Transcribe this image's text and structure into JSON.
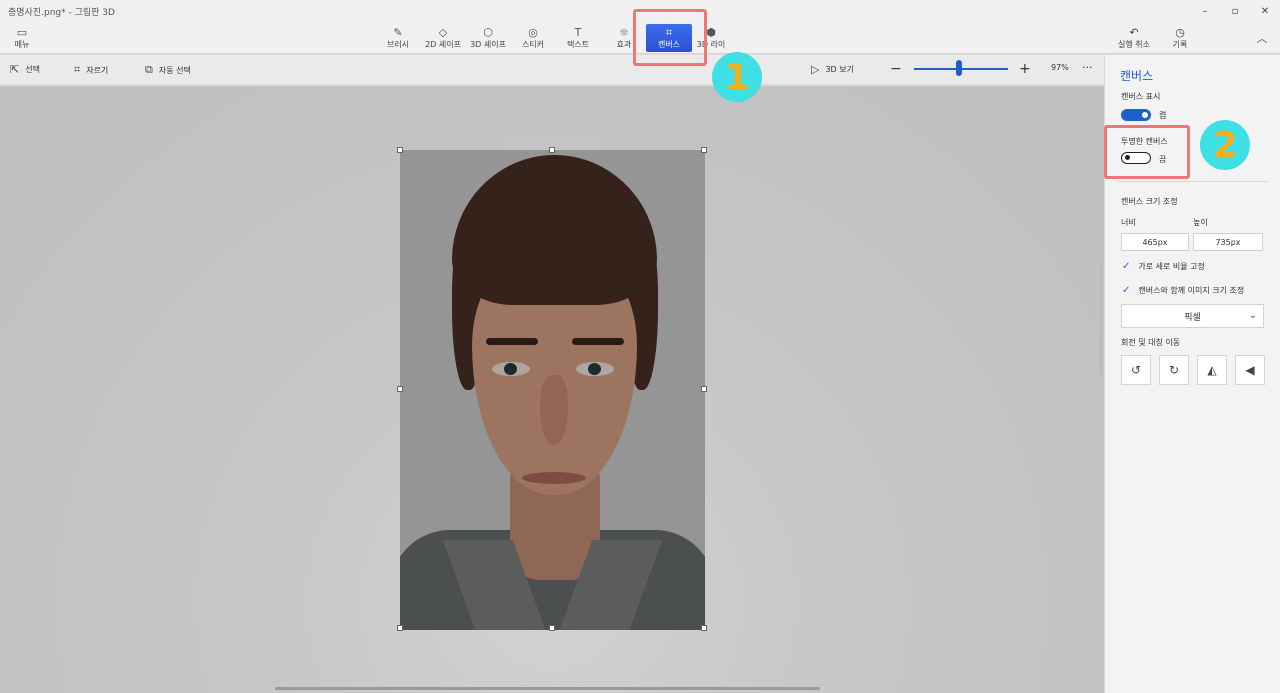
{
  "window": {
    "title": "증명사진.png* - 그림판 3D",
    "controls": {
      "minimize": "–",
      "maximize": "▫",
      "close": "✕"
    }
  },
  "ribbon": {
    "menu": {
      "icon": "folder-icon",
      "label": "메뉴"
    },
    "tools": [
      {
        "id": "brush",
        "icon": "brush-icon",
        "label": "브러시"
      },
      {
        "id": "2d-shapes",
        "icon": "2d-shape-icon",
        "label": "2D 셰이프"
      },
      {
        "id": "3d-shapes",
        "icon": "3d-cube-icon",
        "label": "3D 셰이프"
      },
      {
        "id": "stickers",
        "icon": "sticker-icon",
        "label": "스티커"
      },
      {
        "id": "text",
        "icon": "text-icon",
        "label": "텍스트"
      },
      {
        "id": "effects",
        "icon": "sun-icon",
        "label": "효과"
      },
      {
        "id": "canvas",
        "icon": "canvas-icon",
        "label": "캔버스",
        "active": true
      },
      {
        "id": "3d-library",
        "icon": "3d-library-icon",
        "label": "3D 라이"
      }
    ],
    "undo": {
      "icon": "undo-icon",
      "label": "실행 취소"
    },
    "history": {
      "icon": "history-icon",
      "label": "기록"
    },
    "collapse": "chevron-up-icon"
  },
  "toolbar2": {
    "select": {
      "icon": "pointer-icon",
      "label": "선택"
    },
    "crop": {
      "icon": "crop-icon",
      "label": "자르기"
    },
    "magic_select": {
      "icon": "magic-select-icon",
      "label": "자동 선택"
    },
    "view3d": {
      "icon": "3d-view-icon",
      "label": "3D 보기"
    },
    "zoom_out": "−",
    "zoom_in": "+",
    "zoom_level": "97%",
    "more": "···"
  },
  "panel": {
    "title": "캔버스",
    "show_canvas": {
      "label": "캔버스 표시",
      "state": "켬",
      "on": true
    },
    "transparent_canvas": {
      "label": "투명한 캔버스",
      "state": "끔",
      "on": false
    },
    "resize_header": "캔버스 크기 조정",
    "width_label": "너비",
    "height_label": "높이",
    "width_value": "465px",
    "height_value": "735px",
    "lock_aspect": "가로 세로 비율 고정",
    "resize_with_canvas": "캔버스와 함께 이미지 크기 조정",
    "unit": "픽셀",
    "rotate_flip_header": "회전 및 대칭 이동",
    "rotate_buttons": [
      {
        "icon": "rotate-left-icon",
        "glyph": "↺"
      },
      {
        "icon": "rotate-right-icon",
        "glyph": "↻"
      },
      {
        "icon": "flip-horizontal-icon",
        "glyph": "◭"
      },
      {
        "icon": "flip-vertical-icon",
        "glyph": "◀"
      }
    ]
  },
  "annotations": [
    {
      "number": "1"
    },
    {
      "number": "2"
    }
  ],
  "colors": {
    "accent": "#1e5fc9",
    "highlight": "#f07575",
    "badge_bg": "#3ee0e6",
    "badge_text": "#f2b01e"
  }
}
